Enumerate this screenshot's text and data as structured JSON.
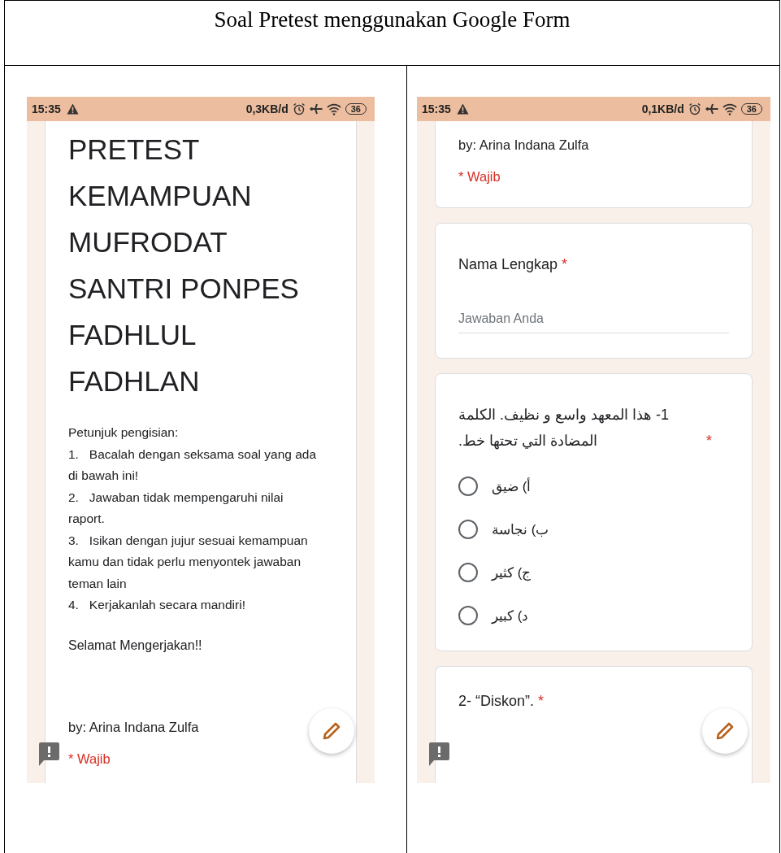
{
  "document_title": "Soal Pretest menggunakan Google Form",
  "screenshots": [
    {
      "status_bar": {
        "time": "15:35",
        "data_rate": "0,3KB/d",
        "battery": "36"
      },
      "blocks": [
        {
          "kind": "header",
          "title": "PRETEST KEMAMPUAN MUFRODAT SANTRI PONPES FADHLUL FADHLAN",
          "instructions": [
            "Petunjuk pengisian:",
            "1.   Bacalah dengan seksama soal yang ada di bawah ini!",
            "2.   Jawaban tidak mempengaruhi nilai raport.",
            "3.   Isikan dengan jujur sesuai kemampuan kamu dan tidak perlu menyontek jawaban teman lain",
            "4.   Kerjakanlah secara mandiri!"
          ],
          "closing": "Selamat Mengerjakan!!",
          "author": "by: Arina Indana Zulfa",
          "required_note": "* Wajib"
        }
      ]
    },
    {
      "status_bar": {
        "time": "15:35",
        "data_rate": "0,1KB/d",
        "battery": "36"
      },
      "blocks": [
        {
          "kind": "header_tail",
          "author": "by: Arina Indana Zulfa",
          "required_note": "* Wajib"
        },
        {
          "kind": "text_question",
          "title": "Nama Lengkap",
          "required_mark": "*",
          "placeholder": "Jawaban Anda"
        },
        {
          "kind": "choice_question",
          "title": "1- هذا المعهد واسع و نظيف. الكلمة المضادة التي تحتها خط.",
          "required_mark": "*",
          "options": [
            {
              "label": "أ) ضيق",
              "selected": false
            },
            {
              "label": "ب) نجاسة",
              "selected": false
            },
            {
              "label": "ج) كثير",
              "selected": false
            },
            {
              "label": "د) كبير",
              "selected": false
            }
          ]
        },
        {
          "kind": "question_stub",
          "title": "2- “Diskon”.",
          "required_mark": "*"
        }
      ]
    }
  ]
}
